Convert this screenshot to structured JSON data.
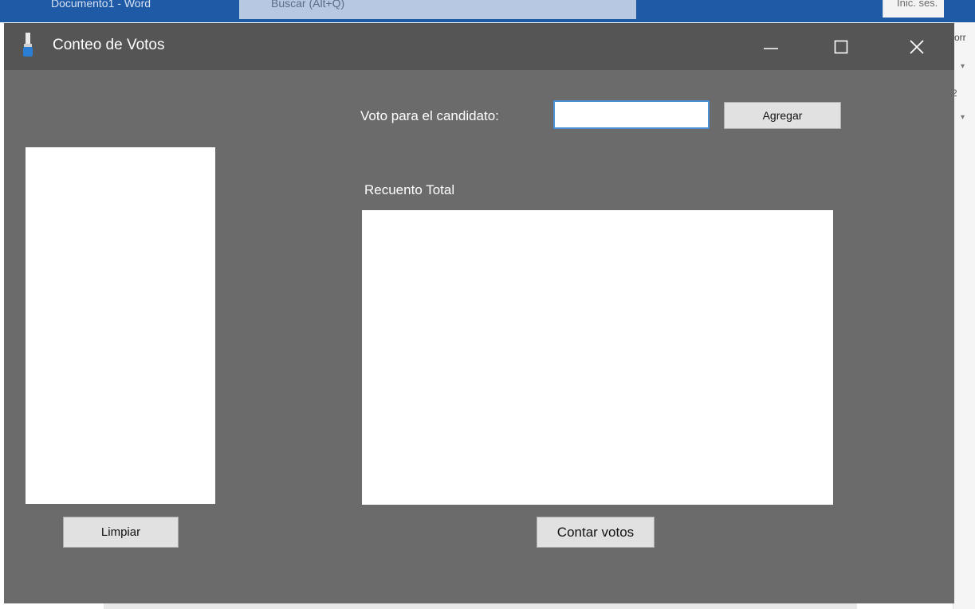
{
  "background": {
    "word_title": "Documento1 - Word",
    "search_text": "Buscar (Alt+Q)",
    "signin_text": "Inic. ses.",
    "ribbon_partial_text": "orr",
    "ribbon_partial_number": "2"
  },
  "window": {
    "title": "Conteo de Votos",
    "icon": "app-icon",
    "controls": {
      "minimize_icon": "minimize-icon",
      "maximize_icon": "maximize-icon",
      "close_icon": "close-icon"
    }
  },
  "form": {
    "vote_label": "Voto para el candidato:",
    "vote_input_value": "",
    "add_button": "Agregar",
    "total_label": "Recuento Total",
    "clear_button": "Limpiar",
    "count_button": "Contar votos"
  },
  "colors": {
    "form_background": "#6b6b6b",
    "titlebar": "#555555",
    "input_focus_border": "#4a8fd6",
    "button_face": "#e1e1e1"
  }
}
